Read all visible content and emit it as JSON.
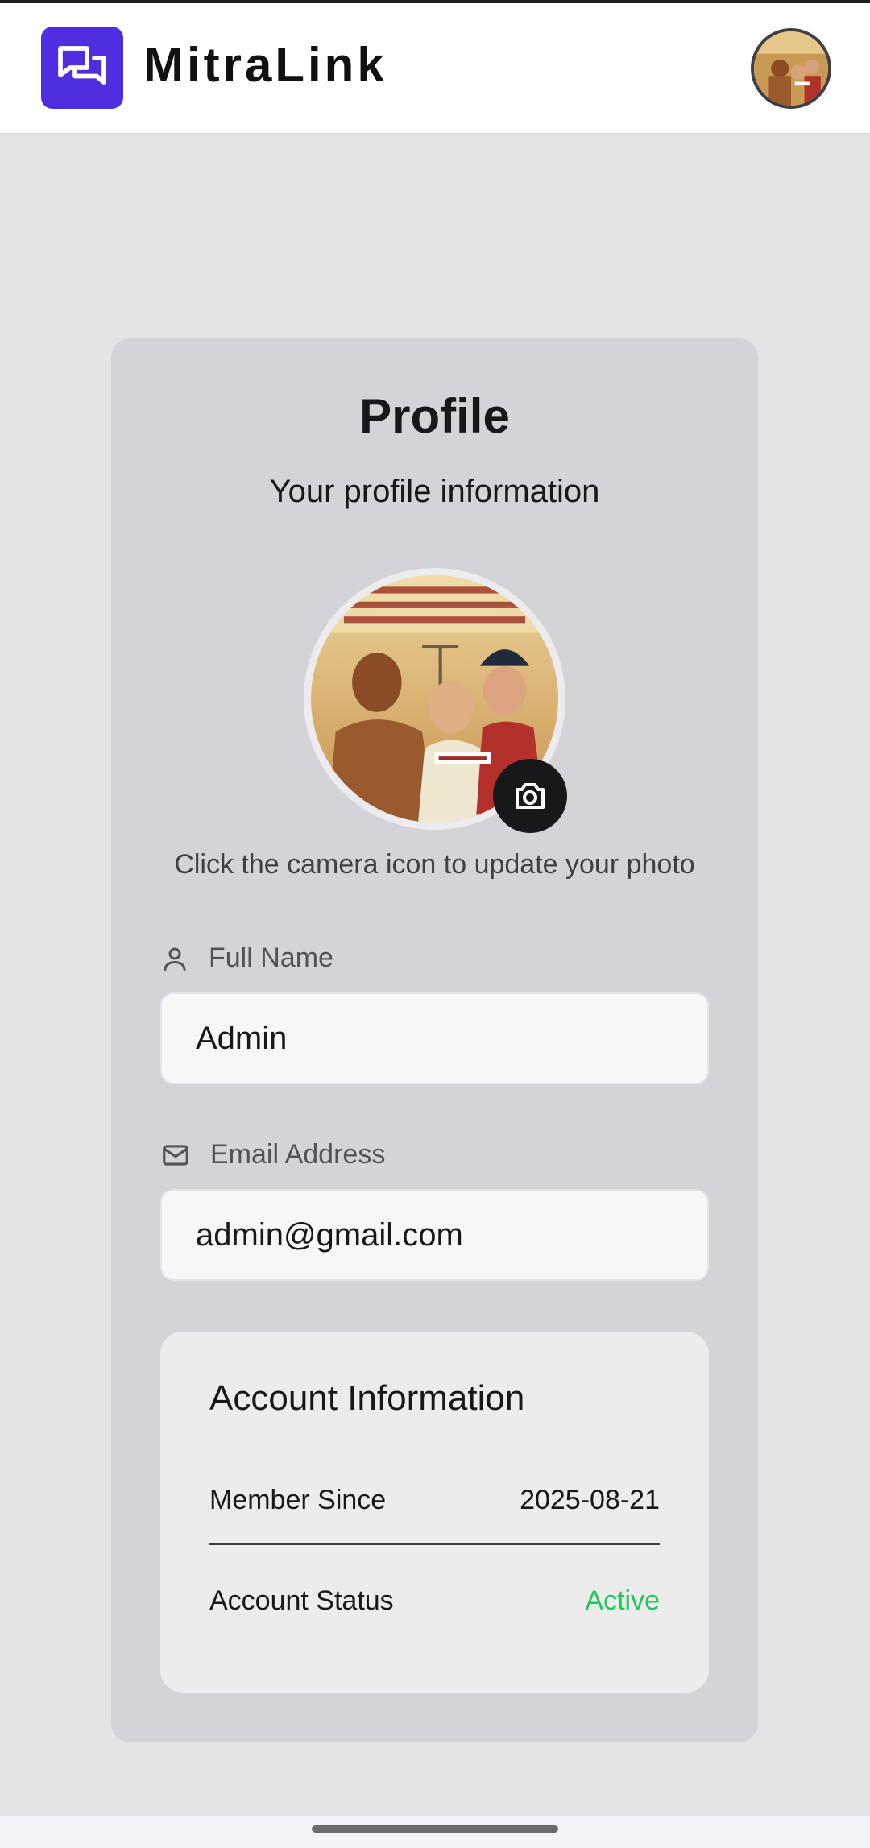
{
  "app": {
    "name": "MitraLink",
    "logo_icon": "chat-bubbles-icon",
    "brand_color": "#4f2ee0"
  },
  "profile": {
    "title": "Profile",
    "subtitle": "Your profile information",
    "photo_hint": "Click the camera icon to update your photo"
  },
  "fields": {
    "full_name": {
      "label": "Full Name",
      "icon": "user-icon",
      "value": "Admin"
    },
    "email": {
      "label": "Email Address",
      "icon": "mail-icon",
      "value": "admin@gmail.com"
    }
  },
  "account": {
    "title": "Account Information",
    "member_since_label": "Member Since",
    "member_since_value": "2025-08-21",
    "status_label": "Account Status",
    "status_value": "Active",
    "status_color": "#22c55e"
  }
}
